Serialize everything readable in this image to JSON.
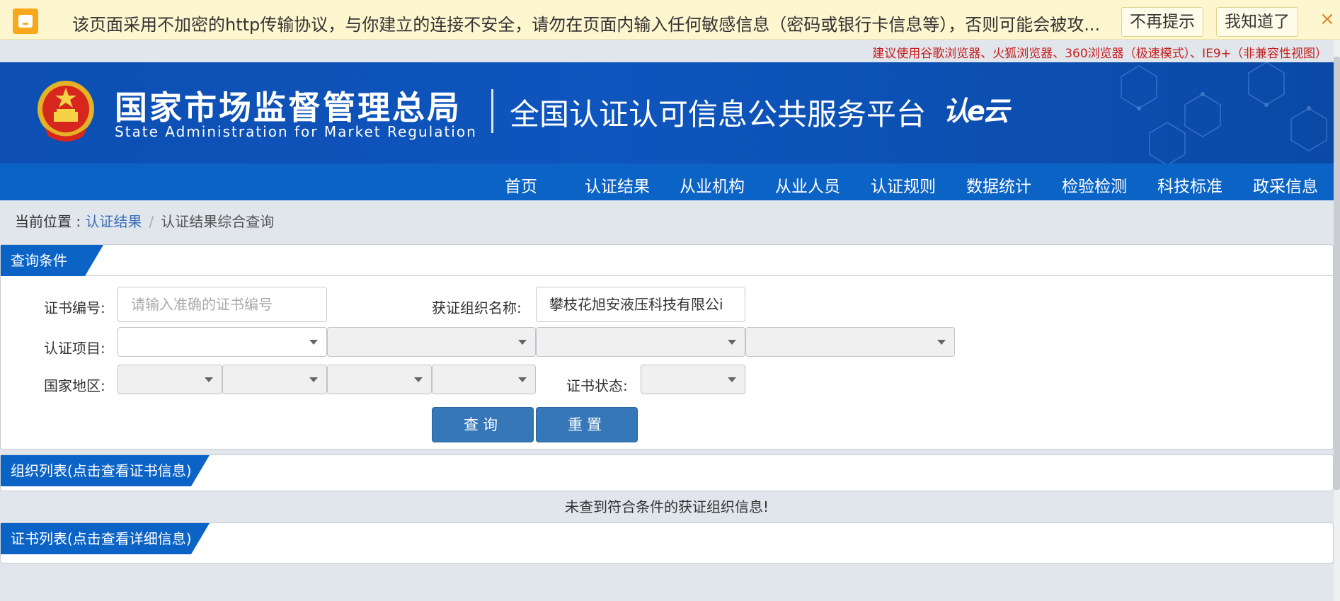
{
  "security_warning": {
    "message": "该页面采用不加密的http传输协议，与你建立的连接不安全，请勿在页面内输入任何敏感信息（密码或银行卡信息等），否则可能会被攻...",
    "dont_remind_label": "不再提示",
    "got_it_label": "我知道了",
    "close_glyph": "×"
  },
  "browser_tip": "建议使用谷歌浏览器、火狐浏览器、360浏览器（极速模式）、IE9+（非兼容性视图）",
  "header": {
    "agency_cn": "国家市场监督管理总局",
    "agency_en": "State Administration  for  Market Regulation",
    "platform_title": "全国认证认可信息公共服务平台",
    "logo_text": "认e云"
  },
  "nav": {
    "items": [
      "首页",
      "认证结果",
      "从业机构",
      "从业人员",
      "认证规则",
      "数据统计",
      "检验检测",
      "科技标准",
      "政采信息"
    ]
  },
  "breadcrumb": {
    "prefix": "当前位置 : ",
    "link": "认证结果",
    "separator": "/",
    "current": "认证结果综合查询"
  },
  "query_panel": {
    "title": "查询条件",
    "cert_no_label": "证书编号:",
    "cert_no_placeholder": "请输入准确的证书编号",
    "org_name_label": "获证组织名称:",
    "org_name_value": "攀枝花旭安液压科技有限公i",
    "project_label": "认证项目:",
    "region_label": "国家地区:",
    "status_label": "证书状态:",
    "search_label": "查询",
    "reset_label": "重置"
  },
  "org_panel": {
    "title": "组织列表(点击查看证书信息)",
    "empty_message": "未查到符合条件的获证组织信息!"
  },
  "cert_panel": {
    "title": "证书列表(点击查看详细信息)"
  },
  "colors": {
    "banner": "#0e55bd",
    "nav": "#0b63c6",
    "button": "#3577b7",
    "warning_bg": "#fdf6cf",
    "tip_red": "#c61d1d"
  }
}
